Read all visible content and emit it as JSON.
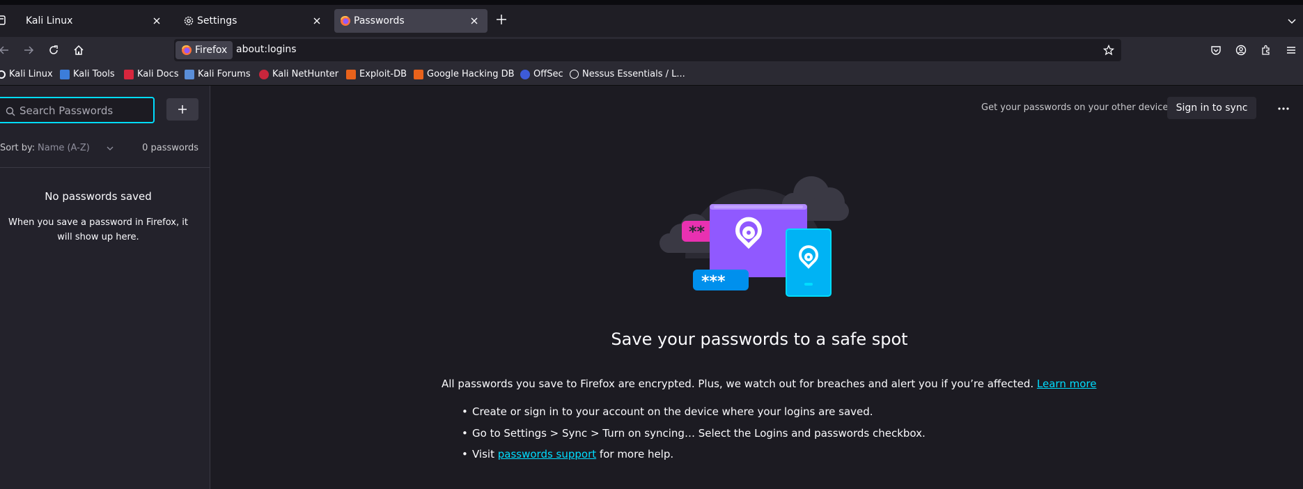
{
  "tabs": [
    {
      "label": "Kali Linux",
      "active": false
    },
    {
      "label": "Settings",
      "active": false
    },
    {
      "label": "Passwords",
      "active": true
    }
  ],
  "urlbar": {
    "identity_label": "Firefox",
    "url": "about:logins"
  },
  "bookmarks": [
    {
      "label": "Kali Linux",
      "icon": "kali-icon"
    },
    {
      "label": "Kali Tools",
      "icon": "kali-tools-icon"
    },
    {
      "label": "Kali Docs",
      "icon": "kali-docs-icon"
    },
    {
      "label": "Kali Forums",
      "icon": "kali-forums-icon"
    },
    {
      "label": "Kali NetHunter",
      "icon": "nethunter-icon"
    },
    {
      "label": "Exploit-DB",
      "icon": "exploit-db-icon"
    },
    {
      "label": "Google Hacking DB",
      "icon": "ghdb-icon"
    },
    {
      "label": "OffSec",
      "icon": "offsec-icon"
    },
    {
      "label": "Nessus Essentials / L...",
      "icon": "globe-icon"
    }
  ],
  "sidebar": {
    "search_placeholder": "Search Passwords",
    "sort_label": "Sort by:",
    "sort_value": "Name (A-Z)",
    "count": "0 passwords",
    "empty_title": "No passwords saved",
    "empty_text": "When you save a password in Firefox, it will show up here."
  },
  "main": {
    "sync_text": "Get your passwords on your other devices",
    "sync_button": "Sign in to sync",
    "headline": "Save your passwords to a safe spot",
    "description": "All passwords you save to Firefox are encrypted. Plus, we watch out for breaches and alert you if you’re affected.",
    "learn_more": "Learn more",
    "bullet1": "Create or sign in to your account on the device where your logins are saved.",
    "bullet2": "Go to Settings > Sync > Turn on syncing… Select the Logins and passwords checkbox.",
    "bullet3_prefix": "Visit",
    "bullet3_link": "passwords support",
    "bullet3_suffix": "for more help.",
    "illustration_text_1": "**",
    "illustration_text_2": "***"
  },
  "colors": {
    "accent": "#00ddff",
    "background": "#1c1b22",
    "sidebar": "#23222b",
    "toolbar": "#2b2a33"
  }
}
